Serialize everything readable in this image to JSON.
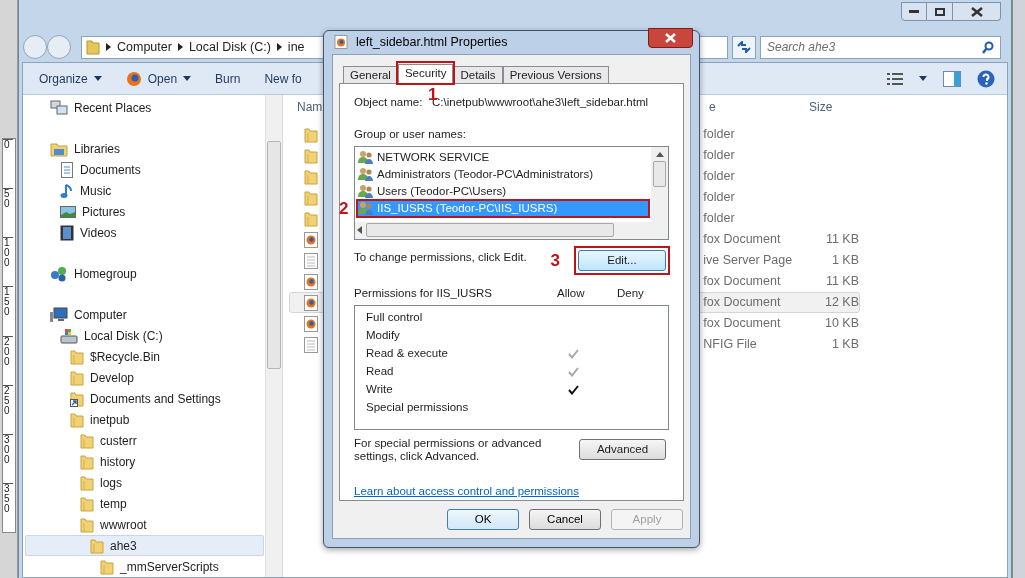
{
  "ruler": {
    "labels": [
      "0",
      "50",
      "100",
      "150",
      "200",
      "250",
      "300",
      "350"
    ]
  },
  "explorer": {
    "breadcrumb": [
      "Computer",
      "Local Disk (C:)",
      "ine"
    ],
    "search": {
      "placeholder": "Search ahe3"
    },
    "toolbar": [
      {
        "label": "Organize",
        "kind": "menu"
      },
      {
        "label": "Open",
        "kind": "open"
      },
      {
        "label": "Burn",
        "kind": "plain"
      },
      {
        "label": "New fo",
        "kind": "plain"
      }
    ],
    "nav": [
      {
        "label": "Recent Places",
        "kind": "recent",
        "selected": false
      },
      {
        "label": "Libraries",
        "kind": "library",
        "selected": false,
        "children": [
          {
            "label": "Documents",
            "kind": "documents",
            "selected": false
          },
          {
            "label": "Music",
            "kind": "music",
            "selected": false
          },
          {
            "label": "Pictures",
            "kind": "pictures",
            "selected": false
          },
          {
            "label": "Videos",
            "kind": "videos",
            "selected": false
          }
        ]
      },
      {
        "label": "Homegroup",
        "kind": "homegroup",
        "selected": false
      },
      {
        "label": "Computer",
        "kind": "computer",
        "selected": false,
        "children": [
          {
            "label": "Local Disk (C:)",
            "kind": "disk",
            "selected": false,
            "children": [
              {
                "label": "$Recycle.Bin",
                "kind": "folder",
                "selected": false
              },
              {
                "label": "Develop",
                "kind": "folder",
                "selected": false
              },
              {
                "label": "Documents and Settings",
                "kind": "shortcut",
                "selected": false
              },
              {
                "label": "inetpub",
                "kind": "folder",
                "selected": false,
                "children": [
                  {
                    "label": "custerr",
                    "kind": "folder",
                    "selected": false
                  },
                  {
                    "label": "history",
                    "kind": "folder",
                    "selected": false
                  },
                  {
                    "label": "logs",
                    "kind": "folder",
                    "selected": false
                  },
                  {
                    "label": "temp",
                    "kind": "folder",
                    "selected": false
                  },
                  {
                    "label": "wwwroot",
                    "kind": "folder",
                    "selected": false,
                    "children": [
                      {
                        "label": "ahe3",
                        "kind": "folder",
                        "selected": true,
                        "children": [
                          {
                            "label": "_mmServerScripts",
                            "kind": "folder",
                            "selected": false
                          }
                        ]
                      }
                    ]
                  }
                ]
              }
            ]
          }
        ]
      }
    ],
    "columns": [
      "Nam",
      "e",
      "Size"
    ],
    "files": [
      {
        "kind": "folder",
        "type": "folder",
        "selected": false
      },
      {
        "kind": "folder",
        "type": "folder",
        "selected": false
      },
      {
        "kind": "folder",
        "type": "folder",
        "selected": false
      },
      {
        "kind": "folder",
        "type": "folder",
        "selected": false
      },
      {
        "kind": "folder",
        "type": "folder",
        "selected": false
      },
      {
        "kind": "firefox",
        "type": "fox Document",
        "size": "11 KB",
        "selected": false
      },
      {
        "kind": "page",
        "type": "ive Server Page",
        "size": "1 KB",
        "selected": false
      },
      {
        "kind": "firefox",
        "type": "fox Document",
        "size": "11 KB",
        "selected": false
      },
      {
        "kind": "firefox",
        "type": "fox Document",
        "size": "12 KB",
        "selected": true
      },
      {
        "kind": "firefox",
        "type": "fox Document",
        "size": "10 KB",
        "selected": false
      },
      {
        "kind": "page",
        "type": "NFIG File",
        "size": "1 KB",
        "selected": false
      }
    ]
  },
  "dialog": {
    "title": "left_sidebar.html Properties",
    "tabs": [
      {
        "label": "General",
        "selected": false
      },
      {
        "label": "Security",
        "selected": true,
        "annotation": "1"
      },
      {
        "label": "Details",
        "selected": false
      },
      {
        "label": "Previous Versions",
        "selected": false
      }
    ],
    "object_label": "Object name:",
    "object_value": "C:\\inetpub\\wwwroot\\ahe3\\left_sidebar.html",
    "group_label": "Group or user names:",
    "users": [
      {
        "label": "NETWORK SERVICE",
        "selected": false
      },
      {
        "label": "Administrators (Teodor-PC\\Administrators)",
        "selected": false
      },
      {
        "label": "Users (Teodor-PC\\Users)",
        "selected": false
      },
      {
        "label": "IIS_IUSRS (Teodor-PC\\IIS_IUSRS)",
        "selected": true,
        "annotation": "2"
      }
    ],
    "change_text": "To change permissions, click Edit.",
    "edit_button": {
      "label": "Edit...",
      "annotation": "3"
    },
    "permissions_label": "Permissions for IIS_IUSRS",
    "allow_label": "Allow",
    "deny_label": "Deny",
    "permissions": [
      {
        "label": "Full control",
        "allow": false
      },
      {
        "label": "Modify",
        "allow": false
      },
      {
        "label": "Read & execute",
        "allow": true,
        "inherited": true
      },
      {
        "label": "Read",
        "allow": true,
        "inherited": true
      },
      {
        "label": "Write",
        "allow": true,
        "inherited": false
      },
      {
        "label": "Special permissions",
        "allow": false
      }
    ],
    "advanced_text": "For special permissions or advanced settings, click Advanced.",
    "advanced_button": "Advanced",
    "link": "Learn about access control and permissions",
    "buttons": [
      {
        "label": "OK",
        "disabled": false,
        "default": true
      },
      {
        "label": "Cancel",
        "disabled": false,
        "default": false
      },
      {
        "label": "Apply",
        "disabled": true,
        "default": false
      }
    ]
  }
}
